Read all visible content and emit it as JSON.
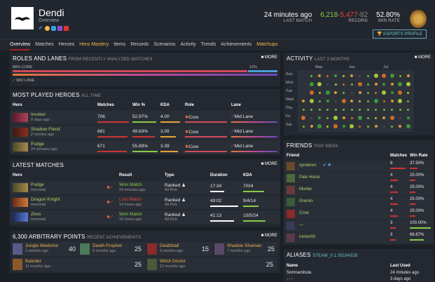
{
  "profile": {
    "name": "Dendi",
    "subtitle": "Overview"
  },
  "header": {
    "last_match_val": "24 minutes ago",
    "last_match_lbl": "LAST MATCH",
    "record_w": "6,218",
    "record_l": "5,477",
    "record_a": "82",
    "record_lbl": "RECORD",
    "winrate_val": "52.80%",
    "winrate_lbl": "WIN RATE",
    "esports": "ESPORTS PROFILE"
  },
  "nav": [
    "Overview",
    "Matches",
    "Heroes",
    "Hero Mastery",
    "Items",
    "Records",
    "Scenarios",
    "Activity",
    "Trends",
    "Achievements",
    "Matchups"
  ],
  "roles": {
    "title": "ROLES AND LANES",
    "sub": "FROM RECENTLY ANALYZED MATCHES",
    "more": "MORE",
    "core": "88% CORE",
    "support": "12%",
    "lane": "MID LANE"
  },
  "most_played": {
    "title": "MOST PLAYED HEROES",
    "sub": "ALL TIME",
    "more": "MORE",
    "headers": [
      "Hero",
      "Matches",
      "Win %",
      "KDA",
      "Role",
      "Lane"
    ],
    "rows": [
      {
        "hero": "Invoker",
        "time": "8 days ago",
        "matches": "706",
        "win": "52.97%",
        "kda": "4.00",
        "role": "Core",
        "lane": "Mid Lane"
      },
      {
        "hero": "Shadow Fiend",
        "time": "2 months ago",
        "matches": "681",
        "win": "49.63%",
        "kda": "3.09",
        "role": "Core",
        "lane": "Mid Lane"
      },
      {
        "hero": "Pudge",
        "time": "24 minutes ago",
        "matches": "671",
        "win": "55.89%",
        "kda": "3.39",
        "role": "Core",
        "lane": "Mid Lane"
      }
    ]
  },
  "latest": {
    "title": "LATEST MATCHES",
    "more": "MORE",
    "headers": [
      "Hero",
      "Result",
      "Type",
      "Duration",
      "KDA"
    ],
    "rows": [
      {
        "hero": "Pudge",
        "skill": "Immortal",
        "result": "Won Match",
        "ago": "24 minutes ago",
        "type": "Ranked",
        "mode": "All Pick",
        "dur": "17:34",
        "kda": "7/0/4"
      },
      {
        "hero": "Dragon Knight",
        "skill": "Immortal",
        "result": "Lost Match",
        "ago": "14 hours ago",
        "type": "Ranked",
        "mode": "All Pick",
        "dur": "49:02",
        "kda": "9/4/14"
      },
      {
        "hero": "Zeus",
        "skill": "Immortal",
        "result": "Won Match",
        "ago": "15 hours ago",
        "type": "Ranked",
        "mode": "All Pick",
        "dur": "41:13",
        "kda": "10/5/24"
      }
    ]
  },
  "points": {
    "title": "6,300 ARBITRARY POINTS",
    "sub": "RECENT ACHIEVEMENTS",
    "more": "MORE",
    "items": [
      {
        "name": "Jungle Medicine",
        "ago": "2 months ago",
        "pts": "40"
      },
      {
        "name": "Death Prophet",
        "ago": "3 months ago",
        "pts": "25"
      },
      {
        "name": "Deathball",
        "ago": "4 months ago",
        "pts": "15"
      },
      {
        "name": "Shadow Shaman",
        "ago": "7 months ago",
        "pts": "25"
      },
      {
        "name": "Batrider",
        "ago": "11 months ago",
        "pts": "25"
      },
      {
        "name": "Witch Doctor",
        "ago": "12 months ago",
        "pts": "25"
      }
    ]
  },
  "activity": {
    "title": "ACTIVITY",
    "sub": "LAST 3 MONTHS",
    "more": "MORE",
    "months": [
      "May",
      "Jun",
      "Jul"
    ],
    "days": [
      "Sun",
      "Mon",
      "Tue",
      "Wed",
      "Thu",
      "Fri",
      "Sat"
    ]
  },
  "friends": {
    "title": "FRIENDS",
    "sub": "THIS WEEK",
    "headers": [
      "Friend",
      "Matches",
      "Win Rate"
    ],
    "rows": [
      {
        "name": "synderen",
        "m": "8",
        "wr": "37.50%"
      },
      {
        "name": "Pale Horse",
        "m": "4",
        "wr": "25.00%"
      },
      {
        "name": "Monke",
        "m": "4",
        "wr": "25.00%"
      },
      {
        "name": "Gremlo",
        "m": "4",
        "wr": "25.00%"
      },
      {
        "name": "Crow",
        "m": "4",
        "wr": "25.00%"
      },
      {
        "name": "---",
        "m": "3",
        "wr": "100.00%"
      },
      {
        "name": "minior00",
        "m": "3",
        "wr": "66.67%"
      }
    ]
  },
  "aliases": {
    "title": "ALIASES",
    "sub": "STEAM_0:1:35194328",
    "headers": [
      "Name",
      "Last Used"
    ],
    "rows": [
      {
        "name": "Somnambula",
        "used": "24 minutes ago"
      },
      {
        "name": "- - -",
        "used": "3 days ago"
      }
    ]
  }
}
